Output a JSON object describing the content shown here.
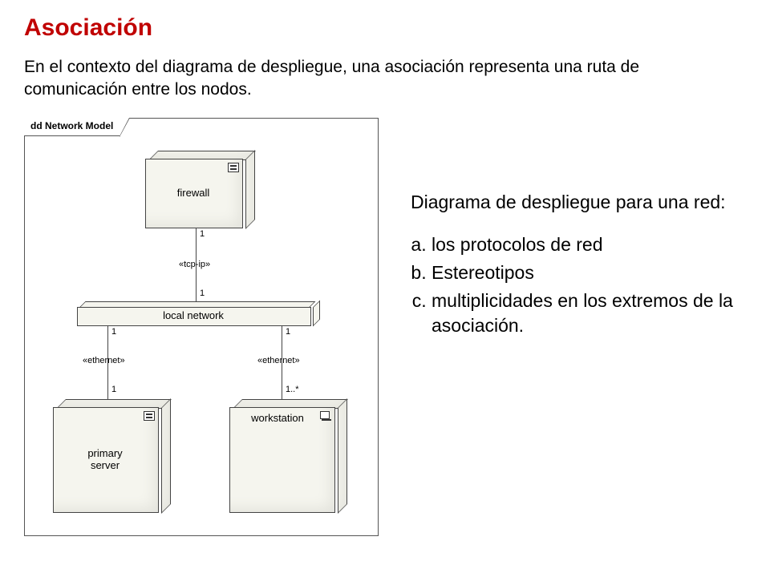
{
  "title": "Asociación",
  "intro": "En el contexto del diagrama de despliegue, una asociación representa una ruta de comunicación entre los nodos.",
  "diagram": {
    "frame_title": "dd Network Model",
    "nodes": {
      "firewall": "firewall",
      "local_network": "local network",
      "primary_server_l1": "primary",
      "primary_server_l2": "server",
      "workstation": "workstation"
    },
    "assoc": {
      "tcp_ip": "«tcp-ip»",
      "ethernet_left": "«ethernet»",
      "ethernet_right": "«ethernet»",
      "m_fw_top": "1",
      "m_fw_bot": "1",
      "m_ln_left_top": "1",
      "m_ln_left_bot": "1",
      "m_ln_right_top": "1",
      "m_ln_right_bot": "1..*"
    }
  },
  "side": {
    "heading": "Diagrama de despliegue para una red:",
    "items": [
      "los protocolos de red",
      "Estereotipos",
      "multiplicidades en los extremos de la asociación."
    ]
  }
}
